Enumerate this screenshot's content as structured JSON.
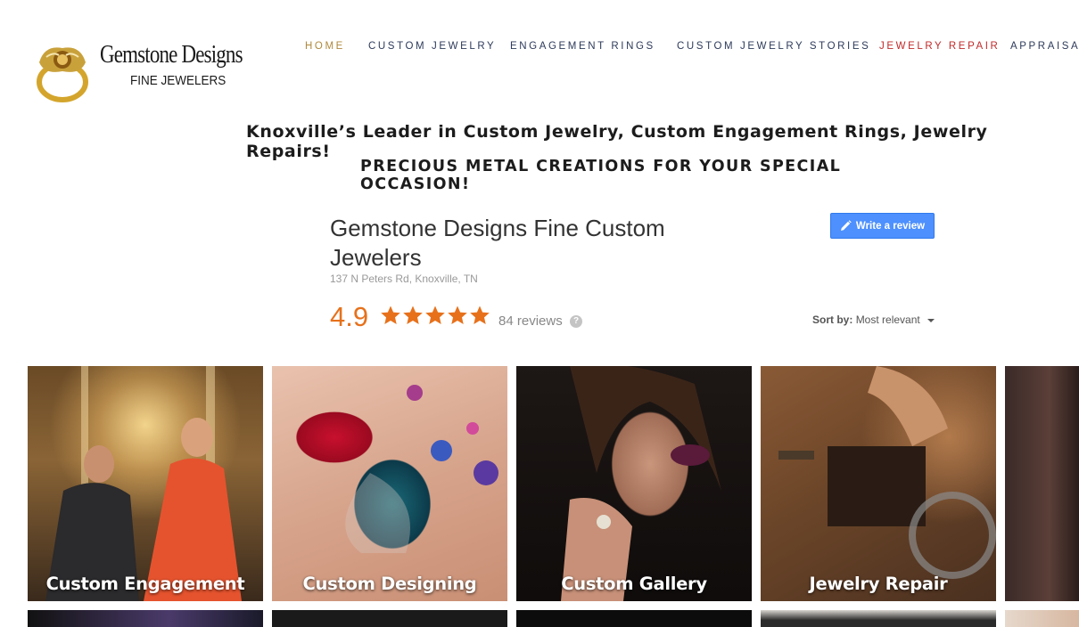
{
  "brand": {
    "name": "Gemstone Designs",
    "tagline": "FINE JEWELERS"
  },
  "nav": {
    "items": [
      {
        "label": "HOME",
        "state": "active"
      },
      {
        "label": "CUSTOM JEWELRY"
      },
      {
        "label": "ENGAGEMENT RINGS"
      },
      {
        "label": "CUSTOM JEWELRY STORIES"
      },
      {
        "label": "JEWELRY REPAIR",
        "state": "highlight"
      },
      {
        "label": "APPRAISAL"
      }
    ]
  },
  "headlines": {
    "main": "Knoxville’s Leader in Custom Jewelry, Custom Engagement Rings, Jewelry Repairs!",
    "sub": "PRECIOUS METAL CREATIONS FOR YOUR SPECIAL OCCASION!"
  },
  "reviews": {
    "business_name": "Gemstone Designs Fine Custom Jewelers",
    "address": "137 N Peters Rd, Knoxville, TN",
    "write_review_label": "Write a review",
    "rating": "4.9",
    "stars": 5,
    "review_count": "84 reviews",
    "help_icon": "?",
    "sort_label": "Sort by:",
    "sort_value": "Most relevant"
  },
  "tiles": [
    {
      "caption": "Custom Engagement"
    },
    {
      "caption": "Custom Designing"
    },
    {
      "caption": "Custom Gallery"
    },
    {
      "caption": "Jewelry Repair"
    }
  ],
  "colors": {
    "nav_active": "#b08a3e",
    "nav_highlight": "#c02a2a",
    "nav_default": "#2d3a5a",
    "rating": "#e7711b",
    "review_button": "#4d90fe"
  }
}
